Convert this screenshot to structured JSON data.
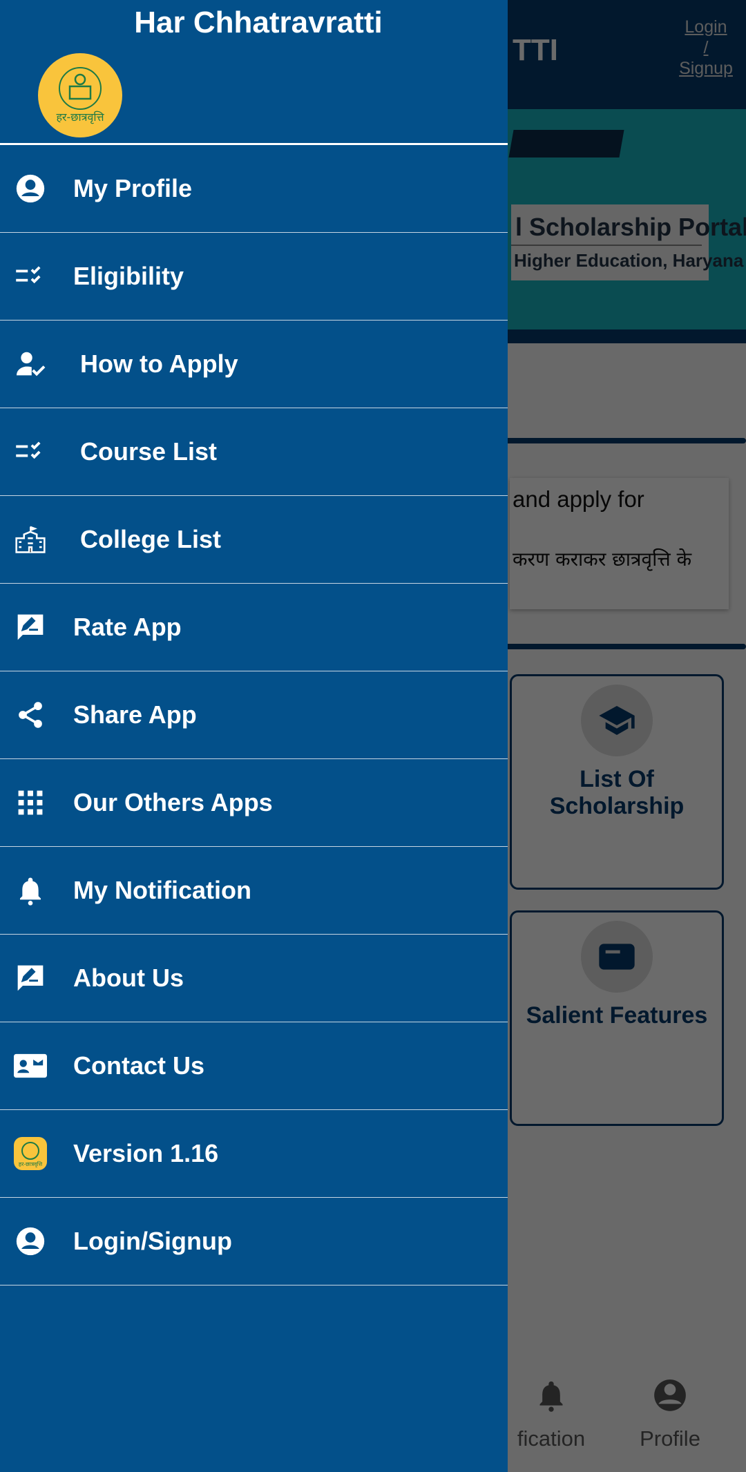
{
  "app_bar": {
    "title_fragment": "TTI",
    "login_line1": "Login",
    "login_sep": "/",
    "login_line2": "Signup"
  },
  "banner": {
    "line1": "l Scholarship Portal",
    "line2": "Higher Education, Haryana"
  },
  "notice": {
    "english": "and apply for",
    "hindi": "करण कराकर छात्रवृत्ति के"
  },
  "cards": [
    {
      "label_line1": "List Of",
      "label_line2": "Scholarship",
      "icon": "graduation-cap-icon"
    },
    {
      "label_line1": "Salient Features",
      "label_line2": "",
      "icon": "card-icon"
    }
  ],
  "bottom_nav": [
    {
      "label": "fication",
      "icon": "bell-icon"
    },
    {
      "label": "Profile",
      "icon": "account-icon"
    }
  ],
  "drawer": {
    "title": "Har Chhatravratti",
    "logo_text": "हर-छात्रवृत्ति",
    "items": [
      {
        "label": "My Profile",
        "icon": "account-circle-icon"
      },
      {
        "label": "Eligibility",
        "icon": "checklist-icon"
      },
      {
        "label": "How to Apply",
        "icon": "person-check-icon"
      },
      {
        "label": "Course List",
        "icon": "checklist-icon"
      },
      {
        "label": "College List",
        "icon": "college-building-icon"
      },
      {
        "label": "Rate App",
        "icon": "rate-review-icon"
      },
      {
        "label": "Share App",
        "icon": "share-icon"
      },
      {
        "label": "Our Others Apps",
        "icon": "apps-grid-icon"
      },
      {
        "label": "My Notification",
        "icon": "bell-icon"
      },
      {
        "label": "About Us",
        "icon": "rate-review-icon"
      },
      {
        "label": "Contact Us",
        "icon": "contact-card-icon"
      },
      {
        "label": "Version 1.16",
        "icon": "app-logo-icon"
      },
      {
        "label": "Login/Signup",
        "icon": "account-circle-icon"
      }
    ]
  },
  "colors": {
    "drawer": "#03508a",
    "primary": "#05386a",
    "logo": "#f9c43c"
  }
}
